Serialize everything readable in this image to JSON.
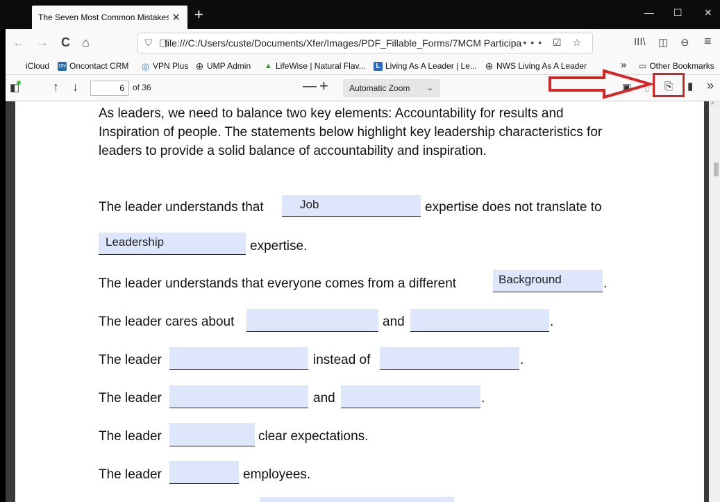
{
  "tab": {
    "title": "The Seven Most Common Mistakes",
    "close": "✕"
  },
  "newtab": "+",
  "window": {
    "minimize": "—",
    "maximize": "☐",
    "close": "✕"
  },
  "nav": {
    "back": "←",
    "forward": "→",
    "reload": "C",
    "home": "⌂",
    "url": "file:///C:/Users/custe/Documents/Xfer/Images/PDF_Fillable_Forms/7MCM Participa",
    "url_icons": "••• ☑ ☆",
    "library": "III\\",
    "sidebar": "◫",
    "account": "⊖",
    "menu": "≡"
  },
  "bookmarks": [
    {
      "label": "iCloud",
      "icon": "apple-icon",
      "color": "#555555",
      "glyph": ""
    },
    {
      "label": "Oncontact CRM",
      "icon": "oncontact-icon",
      "color": "#1f6fb5",
      "glyph": "ON"
    },
    {
      "label": "VPN Plus",
      "icon": "vpn-icon",
      "color": "#1a7fd4",
      "glyph": "◎"
    },
    {
      "label": "UMP Admin",
      "icon": "globe-icon",
      "color": "#333333",
      "glyph": "⊕"
    },
    {
      "label": "LifeWise | Natural Flav...",
      "icon": "leaf-icon",
      "color": "#3a9a2a",
      "glyph": "▲"
    },
    {
      "label": "Living As A Leader | Le...",
      "icon": "lal-icon",
      "color": "#2a6abf",
      "glyph": "L"
    },
    {
      "label": "NWS Living As A Leader",
      "icon": "globe-icon",
      "color": "#333333",
      "glyph": "⊕"
    }
  ],
  "bookmarks_more": "»",
  "other_bookmarks": "Other Bookmarks",
  "pdf": {
    "page_number": "6",
    "page_count": "of 36",
    "zoom": "Automatic Zoom",
    "zoom_minus": "—",
    "zoom_plus": "+"
  },
  "doc": {
    "intro": "As leaders, we need to balance two key elements: Accountability for results and Inspiration of people. The statements below highlight key leadership characteristics for leaders to provide a solid balance of accountability and inspiration.",
    "s1a": "The leader understands that",
    "s1b": "expertise does not translate to",
    "s1c": "expertise.",
    "s2a": "The leader understands that everyone comes from a different",
    "s2b": ".",
    "s3a": "The leader cares about",
    "s3b": "and",
    "s3c": ".",
    "s4a": "The leader",
    "s4b": "instead of",
    "s4c": ".",
    "s5a": "The leader",
    "s5b": "and",
    "s5c": ".",
    "s6a": "The leader",
    "s6b": "clear expectations.",
    "s7a": "The leader",
    "s7b": "employees."
  },
  "fields": {
    "f1": "Job",
    "f2": "Leadership",
    "f3": "Background",
    "f4": "",
    "f5": "",
    "f6": "",
    "f7": "",
    "f8": "",
    "f9": "",
    "f10": "",
    "f11": ""
  },
  "colors": {
    "annotation": "#d42525",
    "field_fill": "#dde6fb"
  }
}
